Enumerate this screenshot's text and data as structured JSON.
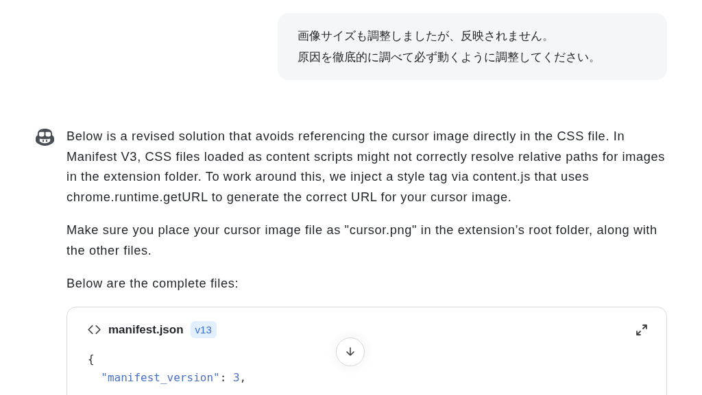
{
  "user_message": {
    "lines": [
      "画像サイズも調整しましたが、反映されません。",
      "原因を徹底的に調べて必ず動くように調整してください。"
    ]
  },
  "assistant_message": {
    "paragraphs": [
      "Below is a revised solution that avoids referencing the cursor image directly in the CSS file. In Manifest V3, CSS files loaded as content scripts might not correctly resolve relative paths for images in the extension folder. To work around this, we inject a style tag via content.js that uses chrome.runtime.getURL to generate the correct URL for your cursor image.",
      "Make sure you place your cursor image file as \"cursor.png\" in the extension’s root folder, along with the other files.",
      "Below are the complete files:"
    ],
    "code_block": {
      "filename": "manifest.json",
      "version": "v13",
      "lines": [
        [
          {
            "kind": "punct",
            "text": "{"
          }
        ],
        [
          {
            "kind": "string",
            "text": "  \"manifest_version\""
          },
          {
            "kind": "punct",
            "text": ": "
          },
          {
            "kind": "number",
            "text": "3"
          },
          {
            "kind": "punct",
            "text": ","
          }
        ]
      ]
    }
  }
}
